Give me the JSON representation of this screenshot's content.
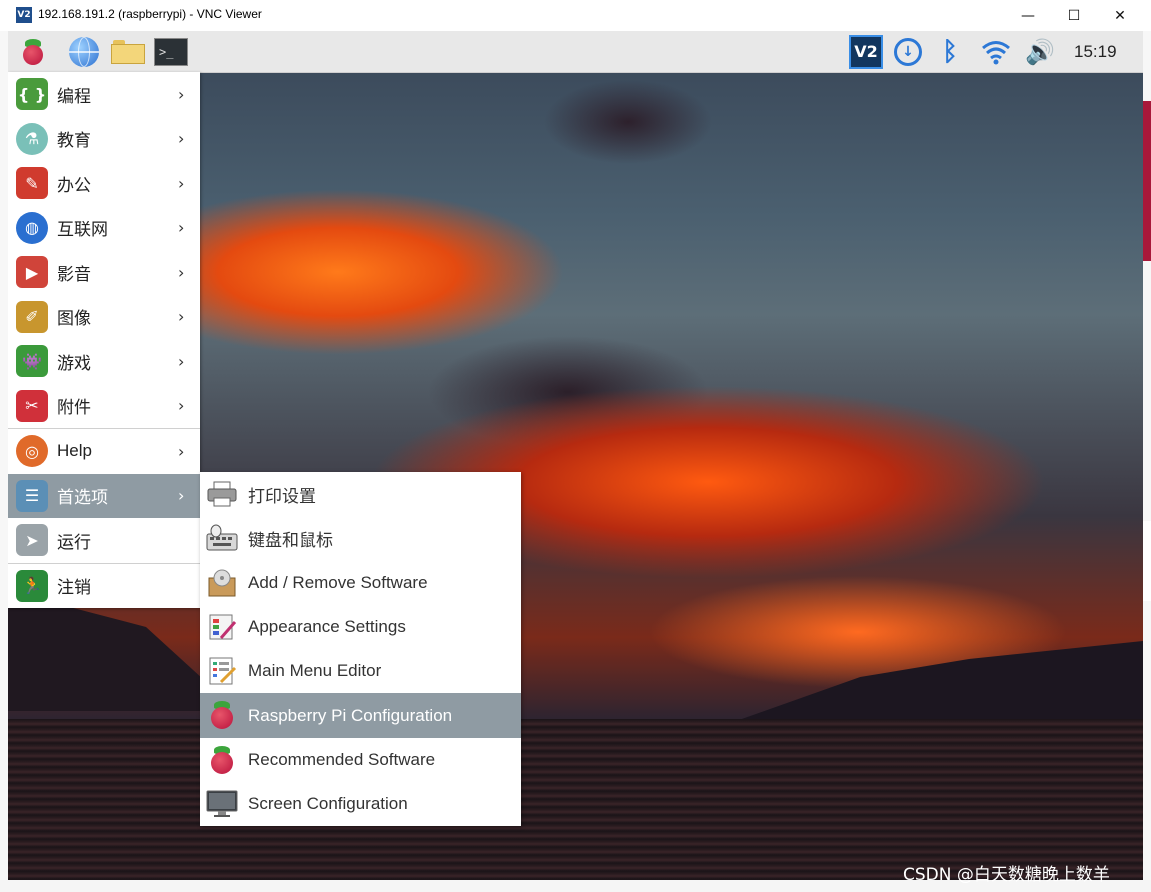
{
  "window": {
    "icon_text": "V2",
    "title": "192.168.191.2 (raspberrypi) - VNC Viewer",
    "minimize": "—",
    "maximize": "☐",
    "close": "✕"
  },
  "panel": {
    "launchers": [
      "raspberry-menu-icon",
      "web-browser-icon",
      "file-manager-icon",
      "terminal-icon"
    ],
    "terminal_glyph": ">_",
    "tray": {
      "vnc_label": "V2",
      "download_glyph": "↓",
      "bluetooth_glyph": "ᛒ",
      "volume_glyph": "🔊",
      "clock": "15:19"
    }
  },
  "menu": {
    "items": [
      {
        "label": "编程",
        "icon": "programming-icon",
        "glyph": "{ }",
        "color": "#4a9b3c"
      },
      {
        "label": "教育",
        "icon": "education-icon",
        "glyph": "⚗",
        "color": "#7ac0b8"
      },
      {
        "label": "办公",
        "icon": "office-icon",
        "glyph": "✎",
        "color": "#d03b2e"
      },
      {
        "label": "互联网",
        "icon": "internet-icon",
        "glyph": "◍",
        "color": "#2a6fd0"
      },
      {
        "label": "影音",
        "icon": "sound-video-icon",
        "glyph": "▶",
        "color": "#d0443a"
      },
      {
        "label": "图像",
        "icon": "graphics-icon",
        "glyph": "✐",
        "color": "#c8962e"
      },
      {
        "label": "游戏",
        "icon": "games-icon",
        "glyph": "👾",
        "color": "#3b9a3b"
      },
      {
        "label": "附件",
        "icon": "accessories-icon",
        "glyph": "✂",
        "color": "#d0303a"
      },
      {
        "label": "Help",
        "icon": "help-icon",
        "glyph": "◎",
        "color": "#e06a2a"
      },
      {
        "label": "首选项",
        "icon": "preferences-icon",
        "glyph": "☰",
        "color": "#5b8fb6"
      },
      {
        "label": "运行",
        "icon": "run-icon",
        "glyph": "➤",
        "color": "#9aa3a8"
      },
      {
        "label": "注销",
        "icon": "logout-icon",
        "glyph": "🏃",
        "color": "#2a8a3a"
      }
    ],
    "arrow": "›"
  },
  "submenu": {
    "items": [
      {
        "label": "打印设置",
        "icon": "printer-icon"
      },
      {
        "label": "键盘和鼠标",
        "icon": "keyboard-mouse-icon"
      },
      {
        "label": "Add / Remove Software",
        "icon": "software-package-icon"
      },
      {
        "label": "Appearance Settings",
        "icon": "appearance-icon"
      },
      {
        "label": "Main Menu Editor",
        "icon": "menu-editor-icon"
      },
      {
        "label": "Raspberry Pi Configuration",
        "icon": "raspberry-config-icon"
      },
      {
        "label": "Recommended Software",
        "icon": "recommended-software-icon"
      },
      {
        "label": "Screen Configuration",
        "icon": "monitor-icon"
      }
    ]
  },
  "watermark": "CSDN @白天数糖晚上数羊",
  "colors": {
    "highlight": "#8f9ba3",
    "tray_blue": "#2c78d6"
  }
}
